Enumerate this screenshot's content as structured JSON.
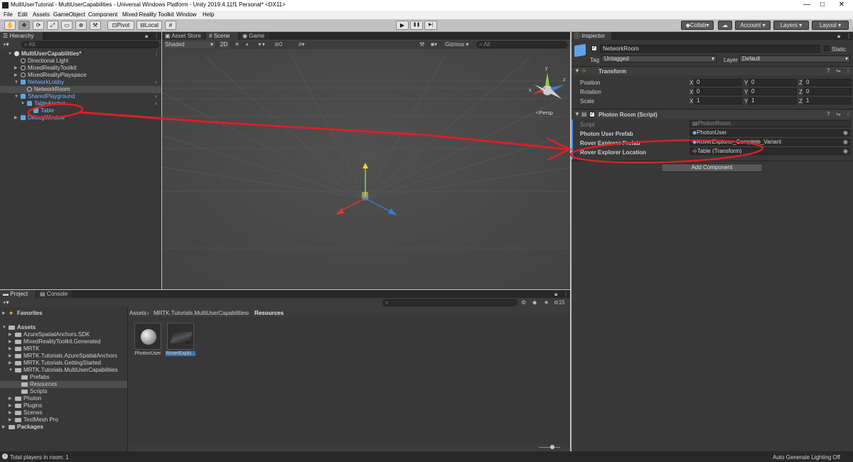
{
  "window": {
    "title": "MultiUserTutorial - MultiUserCapabilities - Universal Windows Platform - Unity 2019.4.11f1 Personal* <DX11>",
    "minimize_glyph": "—",
    "maximize_glyph": "□",
    "close_glyph": "✕"
  },
  "menu": [
    "File",
    "Edit",
    "Assets",
    "GameObject",
    "Component",
    "Mixed Reality Toolkit",
    "Window",
    "Help"
  ],
  "toolbar": {
    "pivot_label": "Pivot",
    "local_label": "Local",
    "collab_label": "Collab",
    "account_label": "Account",
    "layers_label": "Layers",
    "layout_label": "Layout",
    "dropdown_glyph": "▾",
    "play_glyph": "▶",
    "pause_glyph": "❚❚",
    "step_glyph": "▶|",
    "cloud_glyph": "☁"
  },
  "hierarchy": {
    "tab_label": "Hierarchy",
    "add_glyph": "+▾",
    "search_placeholder": "All",
    "items": [
      {
        "label": "MultiUserCapabilities*",
        "indent": 0,
        "arrow": "▼",
        "icon": "scene-icon"
      },
      {
        "label": "Directional Light",
        "indent": 1,
        "arrow": "",
        "icon": "gameobject-icon"
      },
      {
        "label": "MixedRealityToolkit",
        "indent": 1,
        "arrow": "▶",
        "icon": "gameobject-icon"
      },
      {
        "label": "MixedRealityPlayspace",
        "indent": 1,
        "arrow": "▶",
        "icon": "gameobject-icon"
      },
      {
        "label": "NetworkLobby",
        "indent": 1,
        "arrow": "▼",
        "icon": "prefab-icon"
      },
      {
        "label": "NetworkRoom",
        "indent": 2,
        "arrow": "",
        "icon": "gameobject-icon"
      },
      {
        "label": "SharedPlayground",
        "indent": 1,
        "arrow": "▼",
        "icon": "prefab-icon"
      },
      {
        "label": "TableAnchor",
        "indent": 2,
        "arrow": "▼",
        "icon": "prefab-icon"
      },
      {
        "label": "Table",
        "indent": 3,
        "arrow": "",
        "icon": "prefab-icon"
      },
      {
        "label": "DebugWindow",
        "indent": 1,
        "arrow": "▶",
        "icon": "prefab-icon"
      }
    ]
  },
  "scene": {
    "tabs": [
      "Asset Store",
      "Scene",
      "Game"
    ],
    "shading_label": "Shaded",
    "mode_2d_label": "2D",
    "hidden_count": "0",
    "gizmos_label": "Gizmos",
    "search_placeholder": "All",
    "persp_label": "<Persp",
    "gizmo_y_label": "y",
    "gizmo_x_label": "x",
    "gizmo_z_label": "z"
  },
  "inspector": {
    "tab_label": "Inspector",
    "object_name": "NetworkRoom",
    "static_label": "Static",
    "tag_label": "Tag",
    "tag_value": "Untagged",
    "layer_label": "Layer",
    "layer_value": "Default",
    "transform": {
      "title": "Transform",
      "rows": [
        {
          "label": "Position",
          "x": "0",
          "y": "0",
          "z": "0"
        },
        {
          "label": "Rotation",
          "x": "0",
          "y": "0",
          "z": "0"
        },
        {
          "label": "Scale",
          "x": "1",
          "y": "1",
          "z": "1"
        }
      ],
      "axis_x": "X",
      "axis_y": "Y",
      "axis_z": "Z"
    },
    "photon_room": {
      "title": "Photon Room (Script)",
      "script_label": "Script",
      "script_value": "PhotonRoom",
      "fields": [
        {
          "label": "Photon User Prefab",
          "value": "PhotonUser"
        },
        {
          "label": "Rover Explorer Prefab",
          "value": "RoverExplorer_Complete_Variant"
        },
        {
          "label": "Rover Explorer Location",
          "value": "Table (Transform)"
        }
      ]
    },
    "add_component_label": "Add Component"
  },
  "project": {
    "tabs": [
      "Project",
      "Console"
    ],
    "breadcrumb": [
      "Assets",
      "MRTK.Tutorials.MultiUserCapabilities",
      "Resources"
    ],
    "hidden_count": "15",
    "tree": [
      {
        "label": "Favorites",
        "indent": 0,
        "arrow": "▶",
        "bold": true,
        "icon": "star-icon"
      },
      {
        "label": "Assets",
        "indent": 0,
        "arrow": "▼",
        "bold": true,
        "icon": "folder-icon"
      },
      {
        "label": "AzureSpatialAnchors.SDK",
        "indent": 1,
        "arrow": "▶",
        "bold": false,
        "icon": "folder-icon"
      },
      {
        "label": "MixedRealityToolkit.Generated",
        "indent": 1,
        "arrow": "▶",
        "bold": false,
        "icon": "folder-icon"
      },
      {
        "label": "MRTK",
        "indent": 1,
        "arrow": "▶",
        "bold": false,
        "icon": "folder-icon"
      },
      {
        "label": "MRTK.Tutorials.AzureSpatialAnchors",
        "indent": 1,
        "arrow": "▶",
        "bold": false,
        "icon": "folder-icon"
      },
      {
        "label": "MRTK.Tutorials.GettingStarted",
        "indent": 1,
        "arrow": "▶",
        "bold": false,
        "icon": "folder-icon"
      },
      {
        "label": "MRTK.Tutorials.MultiUserCapabilities",
        "indent": 1,
        "arrow": "▼",
        "bold": false,
        "icon": "folder-icon"
      },
      {
        "label": "Prefabs",
        "indent": 2,
        "arrow": "",
        "bold": false,
        "icon": "folder-icon"
      },
      {
        "label": "Resources",
        "indent": 2,
        "arrow": "",
        "bold": false,
        "icon": "folder-icon",
        "selected": true
      },
      {
        "label": "Scripts",
        "indent": 2,
        "arrow": "",
        "bold": false,
        "icon": "folder-icon"
      },
      {
        "label": "Photon",
        "indent": 1,
        "arrow": "▶",
        "bold": false,
        "icon": "folder-icon"
      },
      {
        "label": "Plugins",
        "indent": 1,
        "arrow": "▶",
        "bold": false,
        "icon": "folder-icon"
      },
      {
        "label": "Scenes",
        "indent": 1,
        "arrow": "▶",
        "bold": false,
        "icon": "folder-icon"
      },
      {
        "label": "TextMesh Pro",
        "indent": 1,
        "arrow": "▶",
        "bold": false,
        "icon": "folder-icon"
      },
      {
        "label": "Packages",
        "indent": 0,
        "arrow": "▶",
        "bold": true,
        "icon": "folder-icon"
      }
    ],
    "assets": [
      {
        "label": "PhotonUser",
        "icon": "sphere-prefab-icon"
      },
      {
        "label": "RoverExplo...",
        "icon": "rover-prefab-icon"
      }
    ]
  },
  "status": {
    "message": "Total players in room: 1",
    "right": "Auto Generate Lighting Off"
  },
  "colors": {
    "annotation_red": "#d9202a",
    "prefab_blue": "#7fb0ff",
    "selection": "#4d4d4d"
  }
}
